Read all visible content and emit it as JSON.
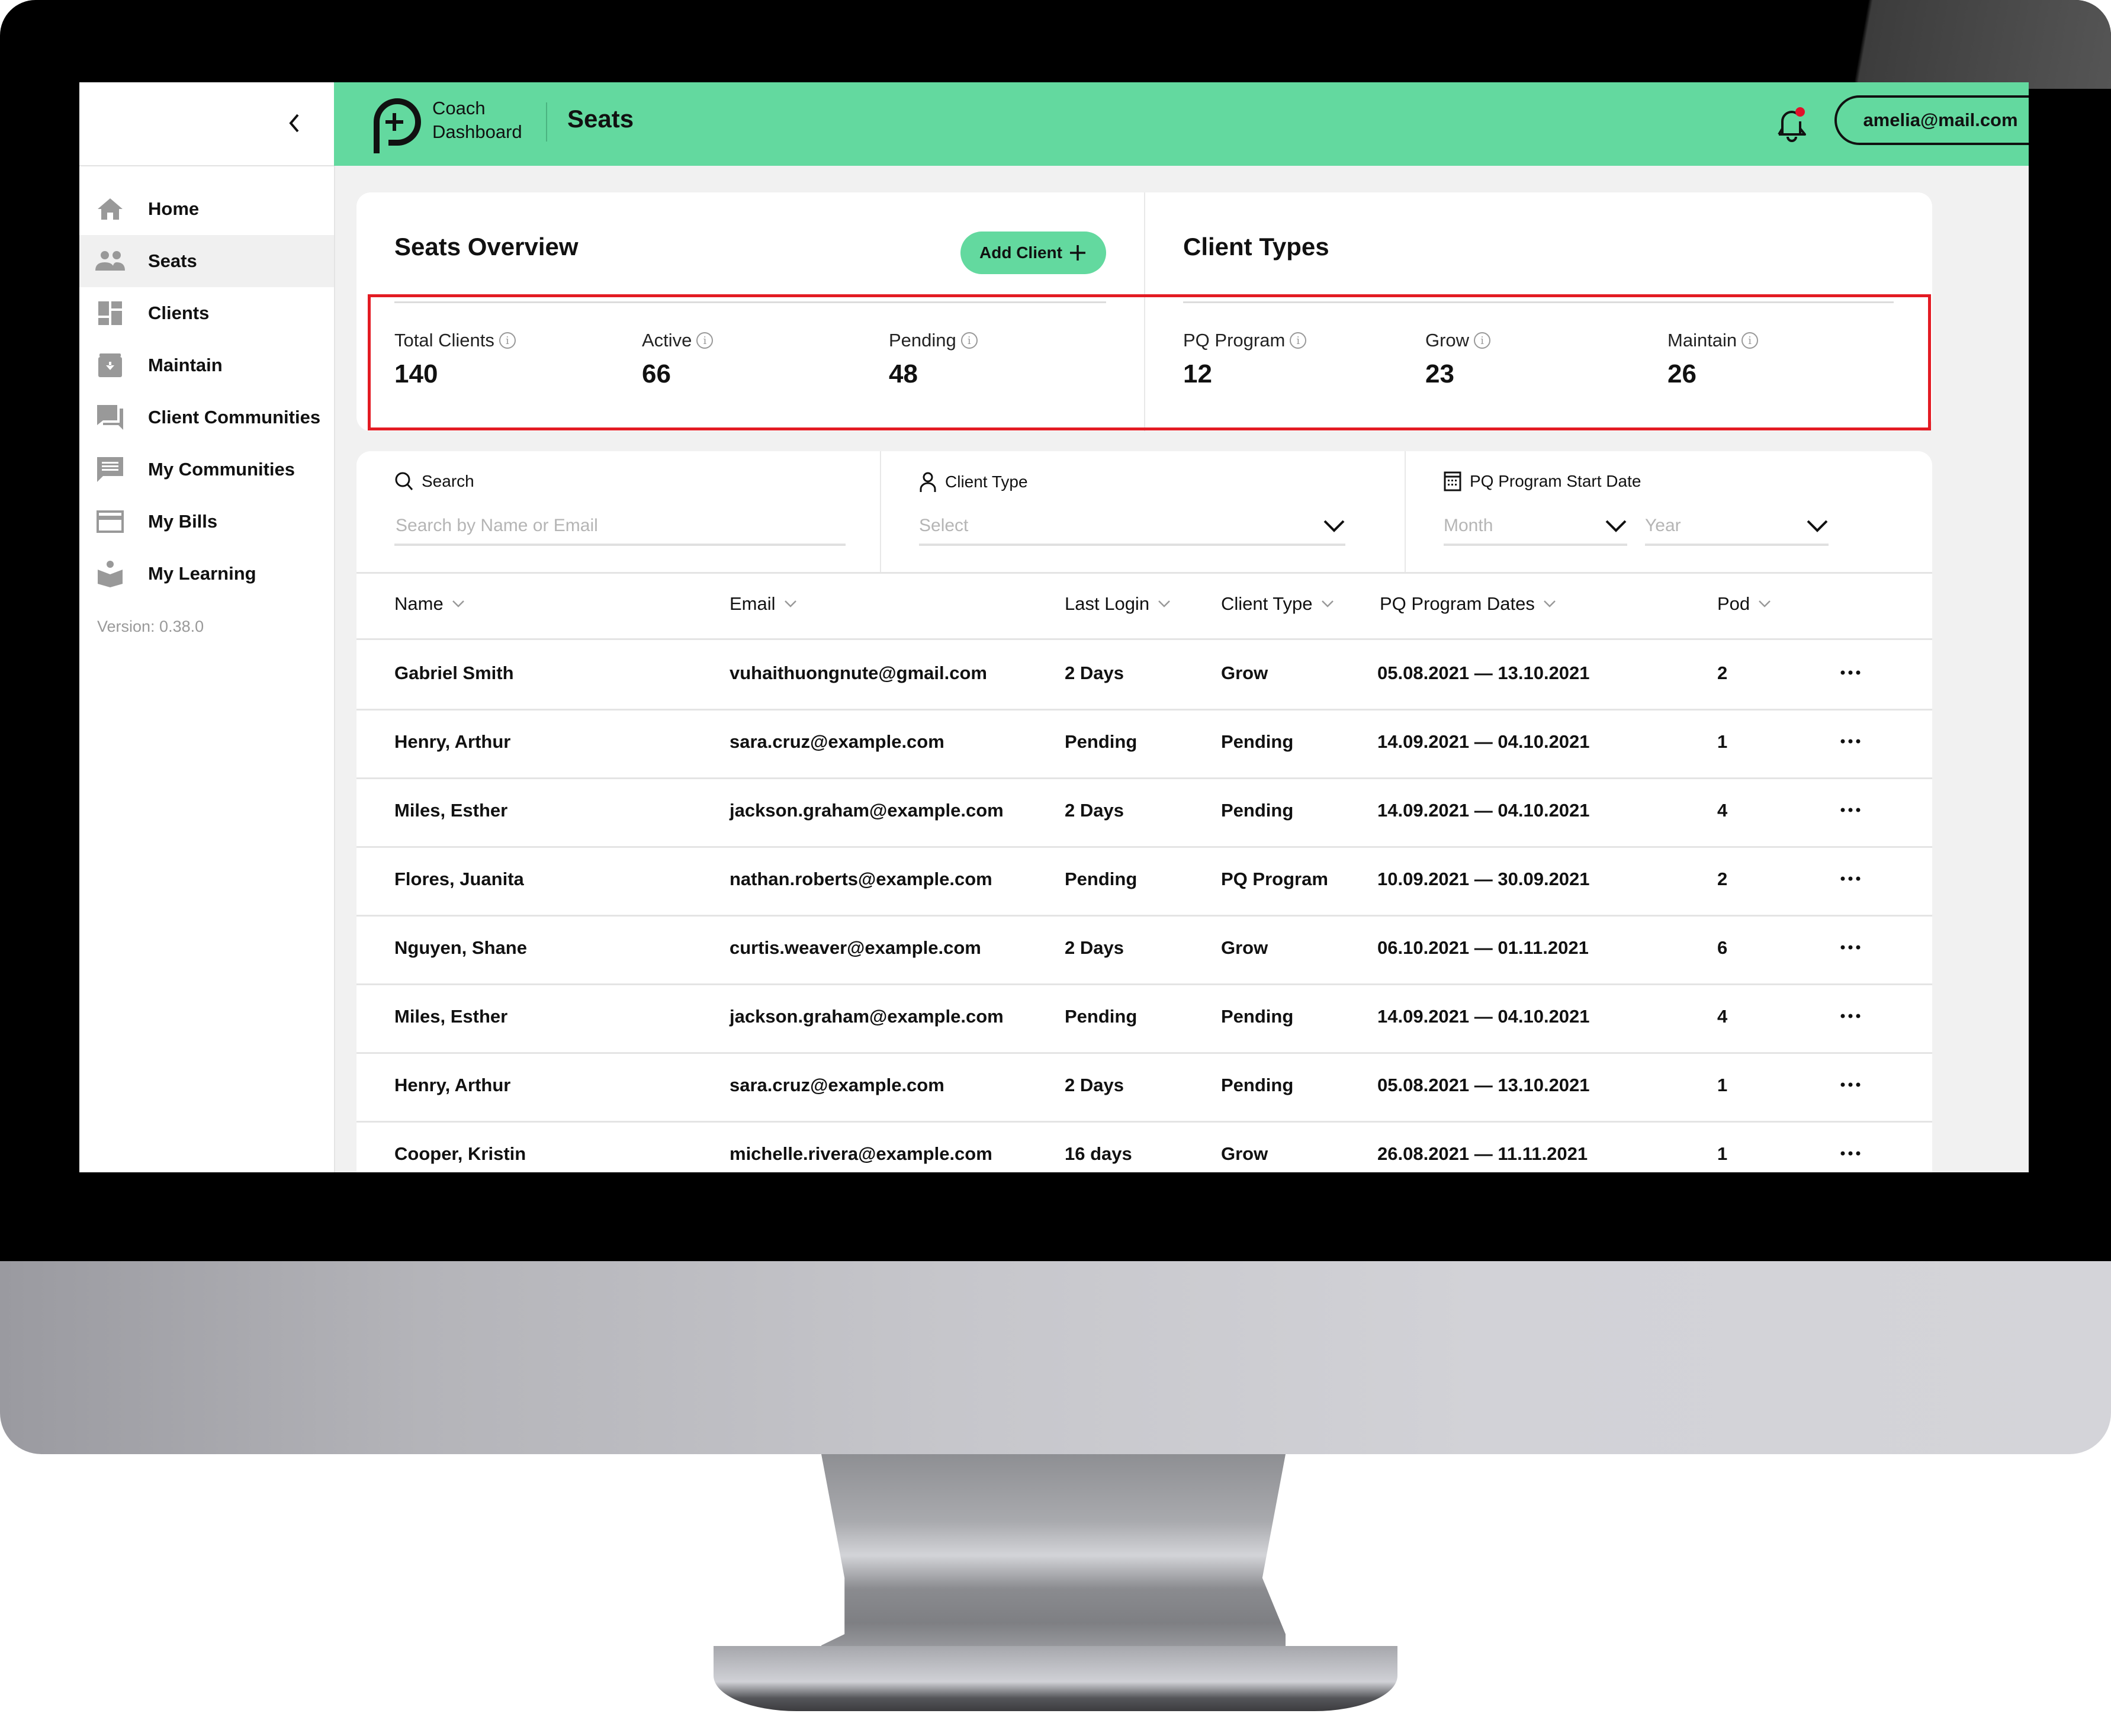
{
  "app": {
    "brand_line1": "Coach",
    "brand_line2": "Dashboard",
    "page_title": "Seats",
    "user_email": "amelia@mail.com",
    "notification_dot_color": "#e0112b",
    "accent_color": "#63d99f"
  },
  "sidebar": {
    "items": [
      {
        "label": "Home",
        "icon": "home-icon"
      },
      {
        "label": "Seats",
        "icon": "people-icon",
        "active": true
      },
      {
        "label": "Clients",
        "icon": "dashboard-icon"
      },
      {
        "label": "Maintain",
        "icon": "archive-icon"
      },
      {
        "label": "Client Communities",
        "icon": "forum-icon"
      },
      {
        "label": "My Communities",
        "icon": "chat-icon"
      },
      {
        "label": "My Bills",
        "icon": "credit-card-icon"
      },
      {
        "label": "My Learning",
        "icon": "reading-icon"
      }
    ],
    "version": "Version: 0.38.0"
  },
  "seats_overview": {
    "title": "Seats Overview",
    "add_client_label": "Add Client",
    "stats": [
      {
        "label": "Total Clients",
        "value": "140"
      },
      {
        "label": "Active",
        "value": "66"
      },
      {
        "label": "Pending",
        "value": "48"
      }
    ]
  },
  "client_types": {
    "title": "Client Types",
    "stats": [
      {
        "label": "PQ Program",
        "value": "12"
      },
      {
        "label": "Grow",
        "value": "23"
      },
      {
        "label": "Maintain",
        "value": "26"
      }
    ]
  },
  "filters": {
    "search": {
      "label": "Search",
      "placeholder": "Search by Name or Email",
      "value": ""
    },
    "client_type": {
      "label": "Client Type",
      "selected": "Select"
    },
    "start_date": {
      "label": "PQ Program Start Date",
      "month": "Month",
      "year": "Year"
    }
  },
  "table": {
    "columns": [
      "Name",
      "Email",
      "Last Login",
      "Client Type",
      "PQ Program Dates",
      "Pod"
    ],
    "rows": [
      {
        "name": "Gabriel Smith",
        "email": "vuhaithuongnute@gmail.com",
        "last_login": "2 Days",
        "client_type": "Grow",
        "dates": "05.08.2021 — 13.10.2021",
        "pod": "2"
      },
      {
        "name": "Henry, Arthur",
        "email": "sara.cruz@example.com",
        "last_login": "Pending",
        "client_type": "Pending",
        "dates": "14.09.2021 — 04.10.2021",
        "pod": "1"
      },
      {
        "name": "Miles, Esther",
        "email": "jackson.graham@example.com",
        "last_login": "2 Days",
        "client_type": "Pending",
        "dates": "14.09.2021 — 04.10.2021",
        "pod": "4"
      },
      {
        "name": "Flores, Juanita",
        "email": "nathan.roberts@example.com",
        "last_login": "Pending",
        "client_type": "PQ Program",
        "dates": "10.09.2021 — 30.09.2021",
        "pod": "2"
      },
      {
        "name": "Nguyen, Shane",
        "email": "curtis.weaver@example.com",
        "last_login": "2 Days",
        "client_type": "Grow",
        "dates": "06.10.2021 — 01.11.2021",
        "pod": "6"
      },
      {
        "name": "Miles, Esther",
        "email": "jackson.graham@example.com",
        "last_login": "Pending",
        "client_type": "Pending",
        "dates": "14.09.2021 — 04.10.2021",
        "pod": "4"
      },
      {
        "name": "Henry, Arthur",
        "email": "sara.cruz@example.com",
        "last_login": "2 Days",
        "client_type": "Pending",
        "dates": "05.08.2021 — 13.10.2021",
        "pod": "1"
      },
      {
        "name": "Cooper, Kristin",
        "email": "michelle.rivera@example.com",
        "last_login": "16 days",
        "client_type": "Grow",
        "dates": "26.08.2021 — 11.11.2021",
        "pod": "1"
      }
    ]
  }
}
